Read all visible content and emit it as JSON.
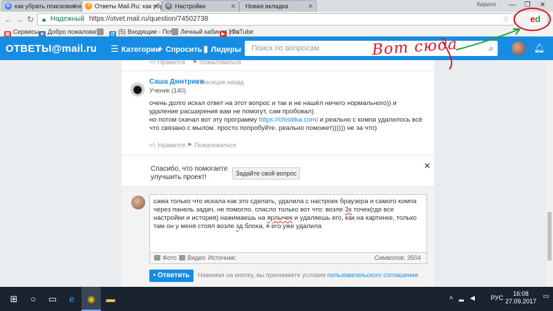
{
  "browser": {
    "tabs": [
      {
        "label": "как убрать поисковик и",
        "icon_letter": "G",
        "icon_color": "#4285f4"
      },
      {
        "label": "Ответы Mail.Ru: как убр",
        "icon_letter": "?",
        "icon_color": "#ff9e00"
      },
      {
        "label": "Настройки",
        "icon_letter": "⚙",
        "icon_color": "#777777"
      },
      {
        "label": "Новая вкладка",
        "icon_letter": "",
        "icon_color": "#bbbbbb"
      }
    ],
    "user_name": "Кирилл",
    "window_buttons": [
      "—",
      "❐",
      "✕"
    ],
    "security_label": "Надежный",
    "url": "https://otvet.mail.ru/question/74502738",
    "bookmarks": [
      {
        "label": "Сервисы",
        "icon": "apps-icon",
        "color": "#d44"
      },
      {
        "label": "Добро пожаловать",
        "icon": "vk-icon",
        "color": "#4a76a8"
      },
      {
        "label": "",
        "icon": "page-icon",
        "color": "#999999"
      },
      {
        "label": "(5) Входящие - Почт",
        "icon": "mail-icon",
        "color": "#168de2"
      },
      {
        "label": "Личный кабинет | Fa",
        "icon": "page-icon",
        "color": "#999999"
      },
      {
        "label": "YouTube",
        "icon": "youtube-icon",
        "color": "#e52d27"
      }
    ]
  },
  "site": {
    "logo": "ОТВЕТЫ@mail.ru",
    "nav": [
      {
        "label": "Категории",
        "icon": "☰"
      },
      {
        "label": "Спросить",
        "icon": "+"
      },
      {
        "label": "Лидеры",
        "icon": "▮"
      }
    ],
    "search_placeholder": "Поиск по вопросам",
    "accent_color": "#168de2"
  },
  "top_actions": {
    "like": "Нравится",
    "complain": "Пожаловаться"
  },
  "answer": {
    "author": "Саша Дмитриев",
    "time": "8 месяцев назад",
    "rank": "Ученик (140)",
    "line1": "очень долго искал ответ на этот вопрос и так и не нашёл ничего нормального)) и удаление расширения вам не помогут, сам пробовал)",
    "line2_prefix": "но потом скачал вот эту программу ",
    "line2_link": "https://chistilka.com/",
    "line2_suffix": " и реально с компа удалилось всё что связано с мылом. просто попробуйте. реально поможет)))))) не за что)",
    "like": "Нравится",
    "complain": "Пожаловаться"
  },
  "promo": {
    "text_line1": "Спасибо, что помогаете",
    "text_line2": "улучшить проект!",
    "button": "Задайте свой вопрос",
    "close": "✕"
  },
  "editor": {
    "p1": "сама только что искала как это сделать, удалила с настроек браузера и самого компа через панель задач, не помогло. спасло только вот что: возле ",
    "p1_u": "3х",
    "p2": " точек(где все настройки и история) нажимаешь на ",
    "p2_u": "ярлычек",
    "p3": " и удаляешь его, как на картинке, только там он у меня стоял возле ",
    "p3_u": "зд",
    "p4": " блока, я его уже удалила",
    "tools": [
      "Фото",
      "Видео",
      "Источник:"
    ],
    "chars_label": "Символов: 3504",
    "submit": "Ответить",
    "terms_prefix": "Нажимая на кнопку, вы принимаете условия ",
    "terms_link": "пользовательского соглашения"
  },
  "annotation": {
    "text": "Вот сюда",
    "color": "#e01520"
  },
  "taskbar": {
    "items": [
      "⊞",
      "○",
      "▭",
      "e",
      "◉",
      "▬"
    ],
    "lang": "РУС",
    "time": "16:08",
    "date": "27.09.2017"
  }
}
